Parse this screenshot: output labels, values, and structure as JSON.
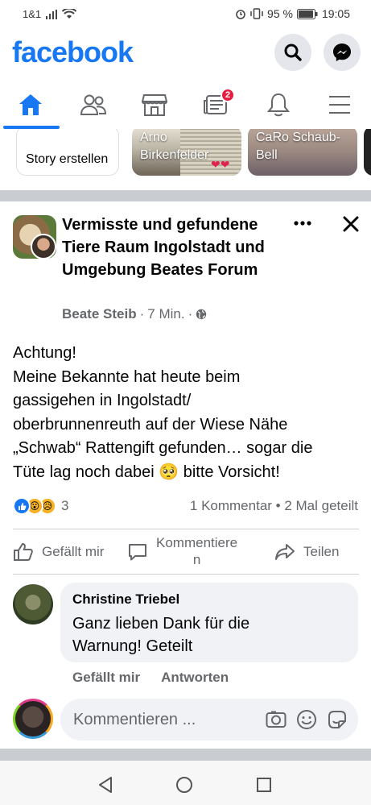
{
  "status_bar": {
    "carrier": "1&1",
    "battery_percent": "95 %",
    "time": "19:05"
  },
  "header": {
    "logo": "facebook",
    "search_icon": "search-icon",
    "messenger_icon": "messenger-icon"
  },
  "nav": {
    "items": [
      "home-icon",
      "friends-icon",
      "marketplace-icon",
      "news-icon",
      "notifications-icon",
      "menu-icon"
    ],
    "active": "home-icon",
    "news_badge": "2",
    "accent_color": "#1877f2"
  },
  "stories": [
    {
      "label": "Story erstellen"
    },
    {
      "name": "Arno Birkenfelder"
    },
    {
      "name": "CaRo Schaub-Bell"
    }
  ],
  "post": {
    "group_title": "Vermisste und gefundene Tiere Raum Ingolstadt  und Umgebung Beates Forum",
    "author": "Beate Steib",
    "time": "7 Min.",
    "body_lines": [
      "Achtung!",
      "Meine Bekannte hat heute beim",
      "gassigehen in Ingolstadt/",
      "oberbrunnenreuth auf der Wiese Nähe",
      "„Schwab“ Rattengift gefunden… sogar die",
      "Tüte lag noch dabei 🥺 bitte Vorsicht!"
    ],
    "reaction_count": "3",
    "stats": "1 Kommentar • 2 Mal geteilt",
    "actions": {
      "like": "Gefällt mir",
      "comment_line1": "Kommentiere",
      "comment_line2": "n",
      "share": "Teilen"
    }
  },
  "comment": {
    "author": "Christine Triebel",
    "text_line1": "Ganz lieben Dank für die",
    "text_line2": "Warnung!   Geteilt",
    "like": "Gefällt mir",
    "reply": "Antworten"
  },
  "composer": {
    "placeholder": "Kommentieren ..."
  }
}
